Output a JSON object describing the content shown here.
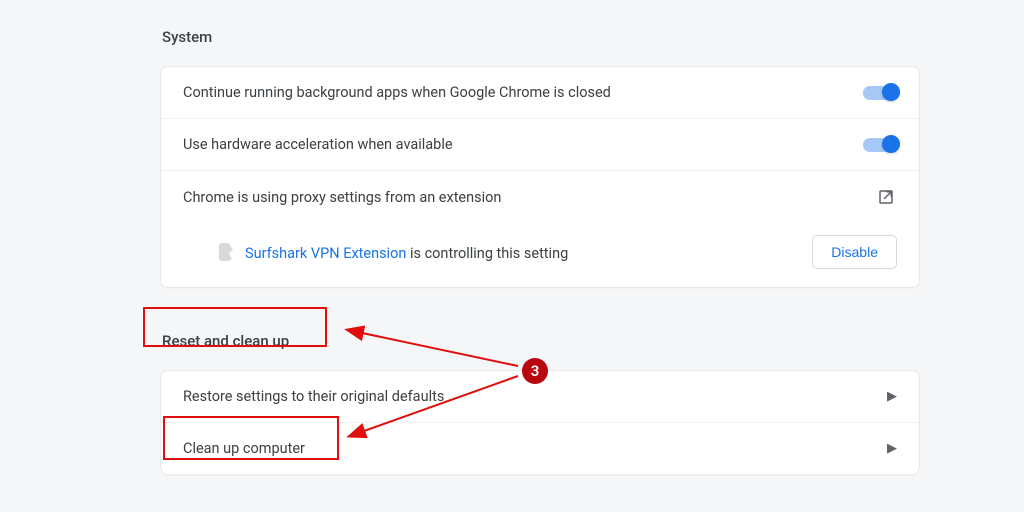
{
  "system": {
    "title": "System",
    "rows": {
      "bg_apps": "Continue running background apps when Google Chrome is closed",
      "hw_accel": "Use hardware acceleration when available",
      "proxy": "Chrome is using proxy settings from an extension"
    },
    "extension_sub": {
      "link": "Surfshark VPN Extension",
      "text": " is controlling this setting",
      "disable": "Disable"
    }
  },
  "reset": {
    "title": "Reset and clean up",
    "rows": {
      "restore": "Restore settings to their original defaults",
      "cleanup": "Clean up computer"
    }
  },
  "annotation": {
    "step_number": "3"
  }
}
